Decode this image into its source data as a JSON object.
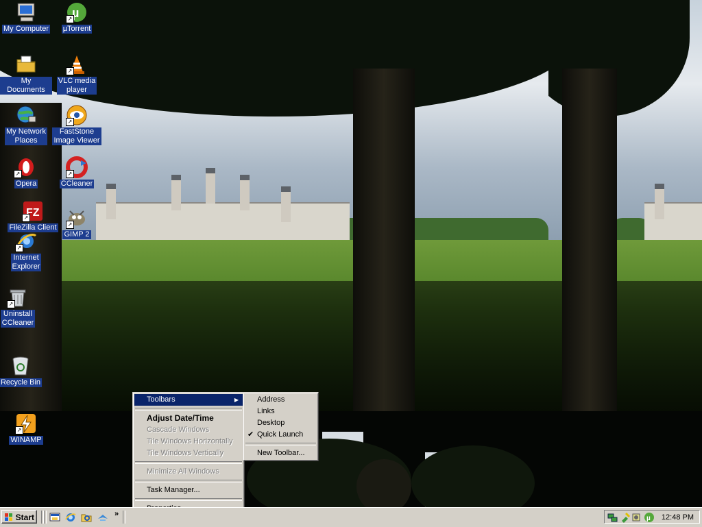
{
  "desktop": {
    "icons": [
      {
        "id": "my-computer",
        "label": "My Computer"
      },
      {
        "id": "utorrent",
        "label": "µTorrent"
      },
      {
        "id": "my-documents",
        "label": "My Documents"
      },
      {
        "id": "vlc",
        "label": "VLC media\nplayer"
      },
      {
        "id": "my-network-places",
        "label": "My Network\nPlaces"
      },
      {
        "id": "faststone",
        "label": "FastStone\nImage Viewer"
      },
      {
        "id": "opera",
        "label": "Opera"
      },
      {
        "id": "ccleaner",
        "label": "CCleaner"
      },
      {
        "id": "filezilla",
        "label": "FileZilla Client"
      },
      {
        "id": "gimp",
        "label": "GIMP 2"
      },
      {
        "id": "internet-explorer",
        "label": "Internet\nExplorer"
      },
      {
        "id": "uninstall-ccleaner",
        "label": "Uninstall\nCCleaner"
      },
      {
        "id": "recycle-bin",
        "label": "Recycle Bin"
      },
      {
        "id": "winamp",
        "label": "WINAMP"
      }
    ]
  },
  "taskbar": {
    "start_label": "Start",
    "overflow_chevron": "»",
    "clock": "12:48 PM"
  },
  "context_menu": {
    "items": [
      {
        "label": "Toolbars",
        "state": "highlighted",
        "submenu": true
      },
      {
        "label": "Adjust Date/Time",
        "state": "default-bold"
      },
      {
        "label": "Cascade Windows",
        "state": "disabled"
      },
      {
        "label": "Tile Windows Horizontally",
        "state": "disabled"
      },
      {
        "label": "Tile Windows Vertically",
        "state": "disabled"
      },
      {
        "label": "Minimize All Windows",
        "state": "disabled"
      },
      {
        "label": "Task Manager...",
        "state": "enabled"
      },
      {
        "label": "Properties",
        "state": "enabled"
      }
    ]
  },
  "toolbars_submenu": {
    "items": [
      {
        "label": "Address",
        "checked": false
      },
      {
        "label": "Links",
        "checked": false
      },
      {
        "label": "Desktop",
        "checked": false
      },
      {
        "label": "Quick Launch",
        "checked": true
      },
      {
        "label": "New Toolbar...",
        "checked": false
      }
    ],
    "check_glyph": "✔"
  },
  "icons": {
    "start_logo": "windows-flag-icon",
    "submenu_arrow": "▶"
  },
  "colors": {
    "menu_highlight": "#0a246a",
    "icon_label_bg": "#1d3d8f",
    "chrome": "#d4d0c8"
  }
}
